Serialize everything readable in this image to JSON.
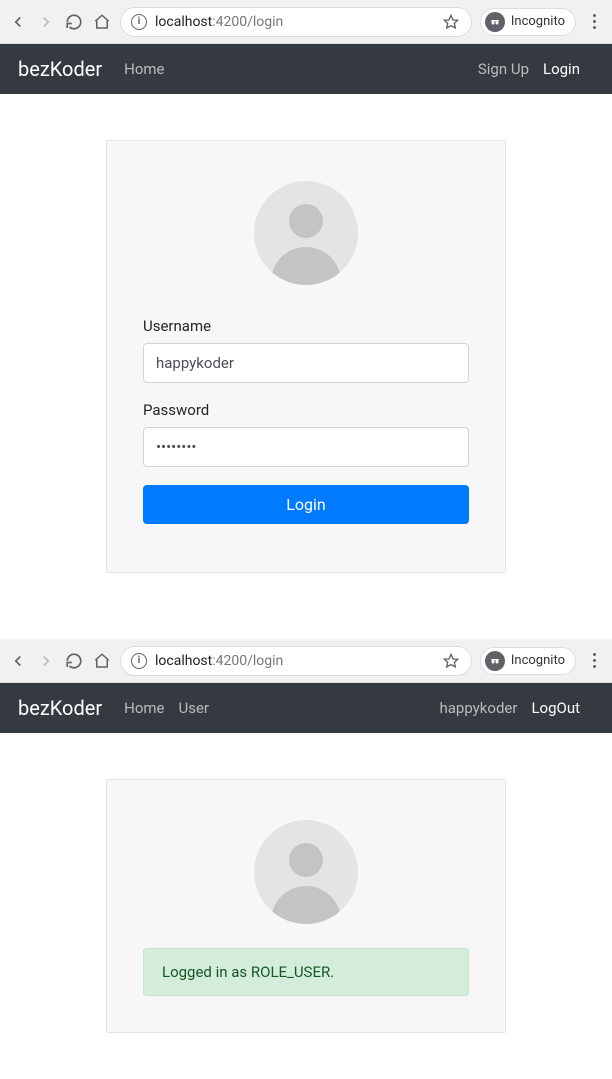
{
  "screen1": {
    "chrome": {
      "url_host": "localhost",
      "url_port_path": ":4200/login",
      "incognito_label": "Incognito"
    },
    "navbar": {
      "brand": "bezKoder",
      "links": {
        "home": "Home"
      },
      "right": {
        "signup": "Sign Up",
        "login": "Login"
      }
    },
    "form": {
      "username_label": "Username",
      "username_value": "happykoder",
      "password_label": "Password",
      "password_value": "••••••••",
      "submit_label": "Login"
    }
  },
  "screen2": {
    "chrome": {
      "url_host": "localhost",
      "url_port_path": ":4200/login",
      "incognito_label": "Incognito"
    },
    "navbar": {
      "brand": "bezKoder",
      "links": {
        "home": "Home",
        "user": "User"
      },
      "right": {
        "username": "happykoder",
        "logout": "LogOut"
      }
    },
    "status": {
      "message": "Logged in as ROLE_USER."
    }
  }
}
